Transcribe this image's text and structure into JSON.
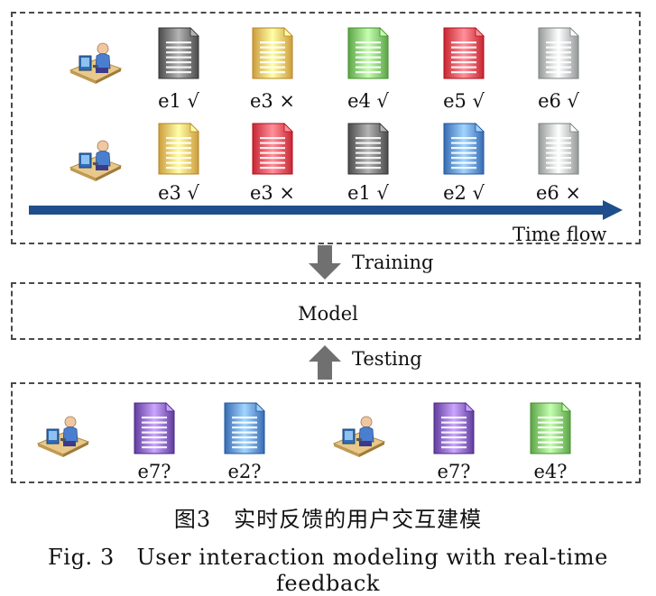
{
  "training": {
    "rows": [
      {
        "docs": [
          {
            "label": "e1 √",
            "color": "#6e6e6e"
          },
          {
            "label": "e3 ×",
            "color": "#f0c060"
          },
          {
            "label": "e4 √",
            "color": "#7fc86a"
          },
          {
            "label": "e5 √",
            "color": "#ea4a55"
          },
          {
            "label": "e6 √",
            "color": "#b8bcbc"
          }
        ]
      },
      {
        "docs": [
          {
            "label": "e3 √",
            "color": "#f0c060"
          },
          {
            "label": "e3 ×",
            "color": "#ea4a55"
          },
          {
            "label": "e1 √",
            "color": "#6e6e6e"
          },
          {
            "label": "e2 √",
            "color": "#5b8fd6"
          },
          {
            "label": "e6 ×",
            "color": "#b8bcbc"
          }
        ]
      }
    ],
    "timeflow_label": "Time flow",
    "arrow_color": "#1f4e8c"
  },
  "training_label": "Training",
  "model_label": "Model",
  "testing_label": "Testing",
  "testing": {
    "docs": [
      {
        "label": "e7?",
        "color": "#8460c0"
      },
      {
        "label": "e2?",
        "color": "#5b8fd6"
      },
      {
        "label": "e7?",
        "color": "#8460c0"
      },
      {
        "label": "e4?",
        "color": "#7fc86a"
      }
    ]
  },
  "caption_cn": "图3　实时反馈的用户交互建模",
  "caption_en": "Fig. 3　User interaction modeling with real-time feedback",
  "icons": {
    "user": "user-at-computer-icon",
    "doc": "document-icon"
  }
}
